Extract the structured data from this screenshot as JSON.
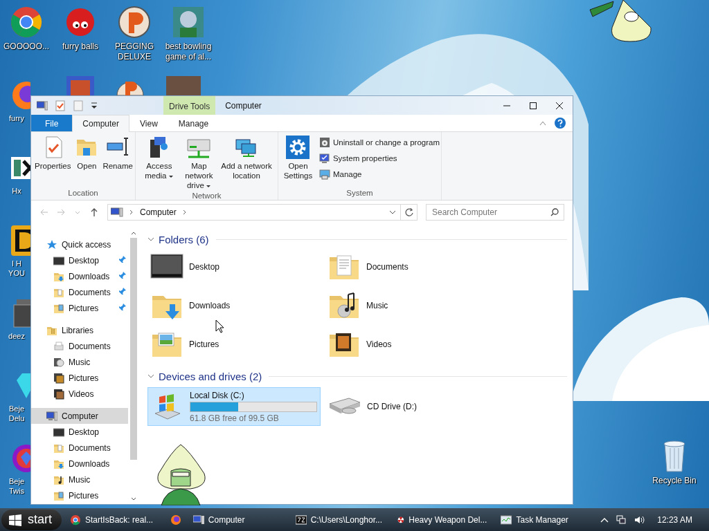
{
  "desktop": {
    "top_icons": [
      {
        "label": "GOOOOO...",
        "kind": "chrome"
      },
      {
        "label": "furry balls",
        "kind": "furball"
      },
      {
        "label": "PEGGING DELUXE",
        "kind": "pegging"
      },
      {
        "label": "best bowling game of al...",
        "kind": "bowling"
      }
    ],
    "left_icons": [
      {
        "label": "furry",
        "kind": "firefox"
      },
      {
        "label": "Hx",
        "kind": "hx"
      },
      {
        "label": "I H YOU",
        "kind": "gold"
      },
      {
        "label": "deez",
        "kind": "stack"
      },
      {
        "label": "Beje Delu",
        "kind": "gem"
      },
      {
        "label": "Beje Twis",
        "kind": "gemtwist"
      }
    ],
    "recycle_bin": {
      "label": "Recycle Bin"
    }
  },
  "window": {
    "title": "Computer",
    "context_tab": "Drive Tools",
    "ribbon_tabs": [
      {
        "label": "File",
        "kind": "file",
        "selected": false
      },
      {
        "label": "Computer",
        "kind": "tab",
        "selected": true
      },
      {
        "label": "View",
        "kind": "tab",
        "selected": false
      },
      {
        "label": "Manage",
        "kind": "tab",
        "selected": false
      }
    ],
    "ribbon_groups": [
      {
        "name": "Location",
        "buttons": [
          {
            "label": "Properties",
            "kind": "properties",
            "dropdown": false
          },
          {
            "label": "Open",
            "kind": "open",
            "dropdown": false
          },
          {
            "label": "Rename",
            "kind": "rename",
            "dropdown": false
          }
        ]
      },
      {
        "name": "Network",
        "buttons": [
          {
            "label": "Access media",
            "kind": "media",
            "dropdown": true
          },
          {
            "label": "Map network drive",
            "kind": "netdrive",
            "dropdown": true
          },
          {
            "label": "Add a network location",
            "kind": "netloc",
            "dropdown": false
          }
        ]
      },
      {
        "name": "System",
        "buttons": [
          {
            "label": "Open Settings",
            "kind": "settings",
            "dropdown": false
          }
        ],
        "small_buttons": [
          {
            "label": "Uninstall or change a program",
            "kind": "uninstall"
          },
          {
            "label": "System properties",
            "kind": "sysprops"
          },
          {
            "label": "Manage",
            "kind": "manage"
          }
        ]
      }
    ],
    "address": {
      "path": [
        "Computer"
      ],
      "search_placeholder": "Search Computer"
    },
    "navigation": [
      {
        "label": "Quick access",
        "kind": "star",
        "selected": false,
        "children": [
          {
            "label": "Desktop",
            "kind": "desktop",
            "selected": false,
            "pinned": true
          },
          {
            "label": "Downloads",
            "kind": "downloads",
            "selected": false,
            "pinned": true
          },
          {
            "label": "Documents",
            "kind": "documents",
            "selected": false,
            "pinned": true
          },
          {
            "label": "Pictures",
            "kind": "pictures",
            "selected": false,
            "pinned": true
          }
        ]
      },
      {
        "label": "Libraries",
        "kind": "library",
        "selected": false,
        "children": [
          {
            "label": "Documents",
            "kind": "libdocs",
            "selected": false
          },
          {
            "label": "Music",
            "kind": "libmusic",
            "selected": false
          },
          {
            "label": "Pictures",
            "kind": "libpictures",
            "selected": false
          },
          {
            "label": "Videos",
            "kind": "libvideos",
            "selected": false
          }
        ]
      },
      {
        "label": "Computer",
        "kind": "computer",
        "selected": true,
        "children": [
          {
            "label": "Desktop",
            "kind": "desktop",
            "selected": false
          },
          {
            "label": "Documents",
            "kind": "documents",
            "selected": false
          },
          {
            "label": "Downloads",
            "kind": "downloads",
            "selected": false
          },
          {
            "label": "Music",
            "kind": "music",
            "selected": false
          },
          {
            "label": "Pictures",
            "kind": "pictures",
            "selected": false
          }
        ]
      }
    ],
    "sections": [
      {
        "title": "Folders (6)",
        "expanded": true,
        "items": [
          {
            "label": "Desktop",
            "kind": "desktop"
          },
          {
            "label": "Documents",
            "kind": "documents"
          },
          {
            "label": "Downloads",
            "kind": "downloads"
          },
          {
            "label": "Music",
            "kind": "music"
          },
          {
            "label": "Pictures",
            "kind": "pictures"
          },
          {
            "label": "Videos",
            "kind": "videos"
          }
        ]
      },
      {
        "title": "Devices and drives (2)",
        "expanded": true,
        "drives": [
          {
            "label": "Local Disk (C:)",
            "kind": "disk",
            "selected": true,
            "level": 0.38,
            "free": "61.8 GB free of 99.5 GB"
          },
          {
            "label": "CD Drive (D:)",
            "kind": "optical",
            "selected": false
          }
        ]
      }
    ]
  },
  "taskbar": {
    "start": "start",
    "items": [
      {
        "label": "StartIsBack: real...",
        "kind": "chrome"
      },
      {
        "kind": "firefox"
      },
      {
        "label": "Computer",
        "kind": "computer"
      },
      {
        "label": "C:\\Users\\Longhor...",
        "kind": "archive"
      },
      {
        "label": "Heavy Weapon Del...",
        "kind": "hazard"
      },
      {
        "label": "Task Manager",
        "kind": "taskmgr"
      }
    ],
    "clock": "12:23 AM"
  }
}
